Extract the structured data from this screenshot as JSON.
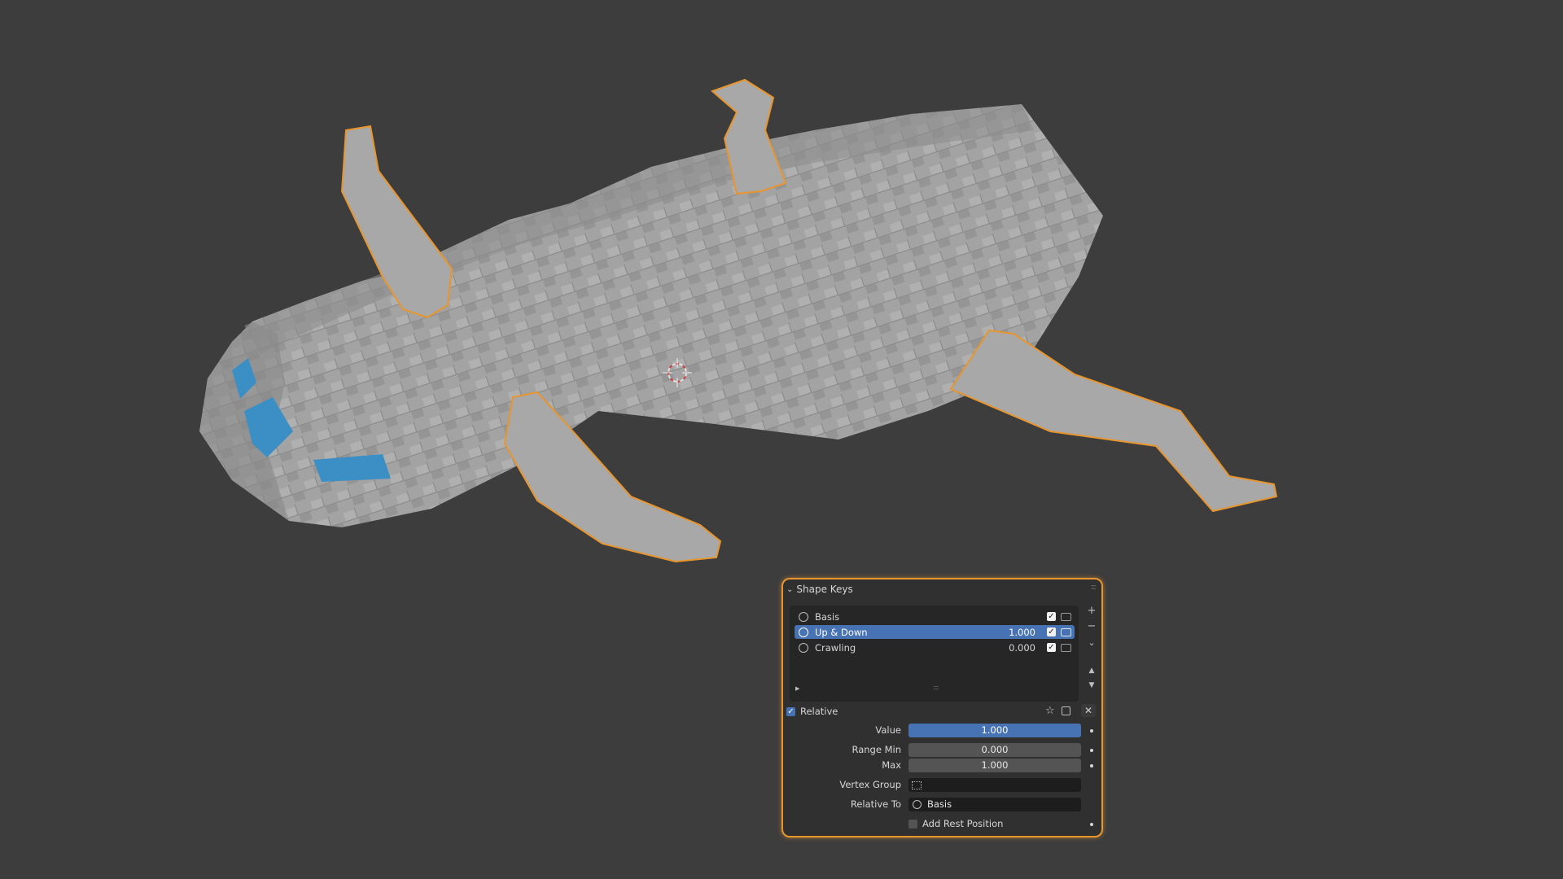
{
  "viewport": {
    "mesh_color": "#9a9a9a",
    "selection_outline_color": "#e8952e",
    "selected_face_color": "#3b8fc4",
    "background_color": "#3d3d3d",
    "cursor_icon": "3d-cursor-icon"
  },
  "panel": {
    "title": "Shape Keys",
    "accent": "#4772b3",
    "shape_keys": [
      {
        "name": "Basis",
        "value": "",
        "selected": false
      },
      {
        "name": "Up & Down",
        "value": "1.000",
        "selected": true
      },
      {
        "name": "Crawling",
        "value": "0.000",
        "selected": false
      }
    ],
    "relative_label": "Relative",
    "value_label": "Value",
    "value": "1.000",
    "range_min_label": "Range Min",
    "range_min": "0.000",
    "max_label": "Max",
    "max": "1.000",
    "vertex_group_label": "Vertex Group",
    "vertex_group": "",
    "relative_to_label": "Relative To",
    "relative_to": "Basis",
    "add_rest_position_label": "Add Rest Position"
  }
}
